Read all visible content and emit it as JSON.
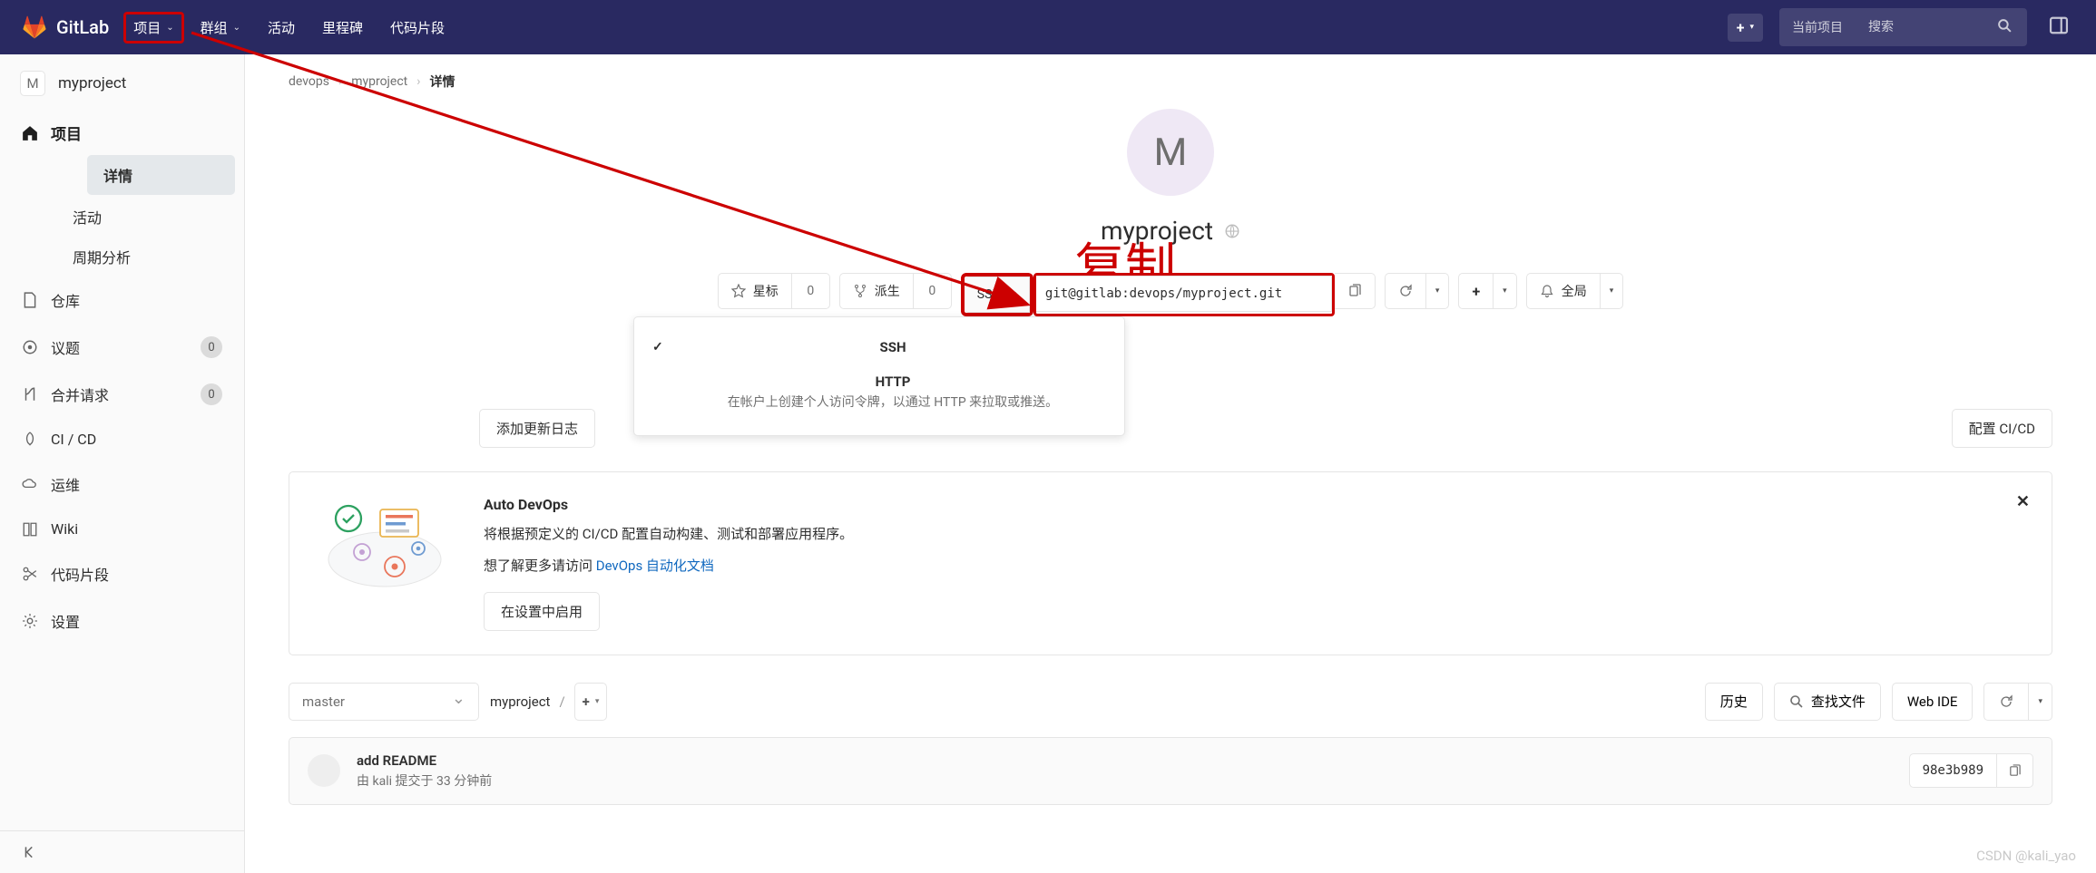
{
  "navbar": {
    "brand": "GitLab",
    "items": [
      {
        "label": "项目",
        "dropdown": true,
        "boxed": true
      },
      {
        "label": "群组",
        "dropdown": true
      },
      {
        "label": "活动"
      },
      {
        "label": "里程碑"
      },
      {
        "label": "代码片段"
      }
    ],
    "search_scope": "当前项目",
    "search_placeholder": "搜索"
  },
  "sidebar": {
    "project_letter": "M",
    "project_name": "myproject",
    "group_label": "项目",
    "sub_items": [
      {
        "label": "详情",
        "active": true
      },
      {
        "label": "活动"
      },
      {
        "label": "周期分析"
      }
    ],
    "items": [
      {
        "label": "仓库"
      },
      {
        "label": "议题",
        "badge": "0"
      },
      {
        "label": "合并请求",
        "badge": "0"
      },
      {
        "label": "CI / CD"
      },
      {
        "label": "运维"
      },
      {
        "label": "Wiki"
      },
      {
        "label": "代码片段"
      },
      {
        "label": "设置"
      }
    ]
  },
  "breadcrumb": {
    "items": [
      "devops",
      "myproject"
    ],
    "current": "详情"
  },
  "hero": {
    "letter": "M",
    "name": "myproject",
    "annotation": "复制"
  },
  "toolbar": {
    "star_label": "星标",
    "star_count": "0",
    "fork_label": "派生",
    "fork_count": "0",
    "protocol": "SSH",
    "clone_url": "git@gitlab:devops/myproject.git",
    "notify_label": "全局"
  },
  "protocol_dropdown": {
    "ssh": {
      "title": "SSH"
    },
    "http": {
      "title": "HTTP",
      "desc": "在帐户上创建个人访问令牌，以通过 HTTP 来拉取或推送。"
    }
  },
  "cicd": {
    "add_changelog": "添加更新日志",
    "config_cicd": "配置 CI/CD"
  },
  "devops": {
    "title": "Auto DevOps",
    "line1": "将根据预定义的 CI/CD 配置自动构建、测试和部署应用程序。",
    "line2_prefix": "想了解更多请访问 ",
    "link_text": "DevOps 自动化文档",
    "enable_btn": "在设置中启用"
  },
  "repo": {
    "branch": "master",
    "breadcrumb": "myproject",
    "plus": "+",
    "history": "历史",
    "find": "查找文件",
    "webide": "Web IDE"
  },
  "commit": {
    "message": "add README",
    "author": "kali",
    "by": "由",
    "submitted": "提交于",
    "when": "33 分钟前",
    "sha": "98e3b989"
  },
  "watermark": "CSDN @kali_yao"
}
